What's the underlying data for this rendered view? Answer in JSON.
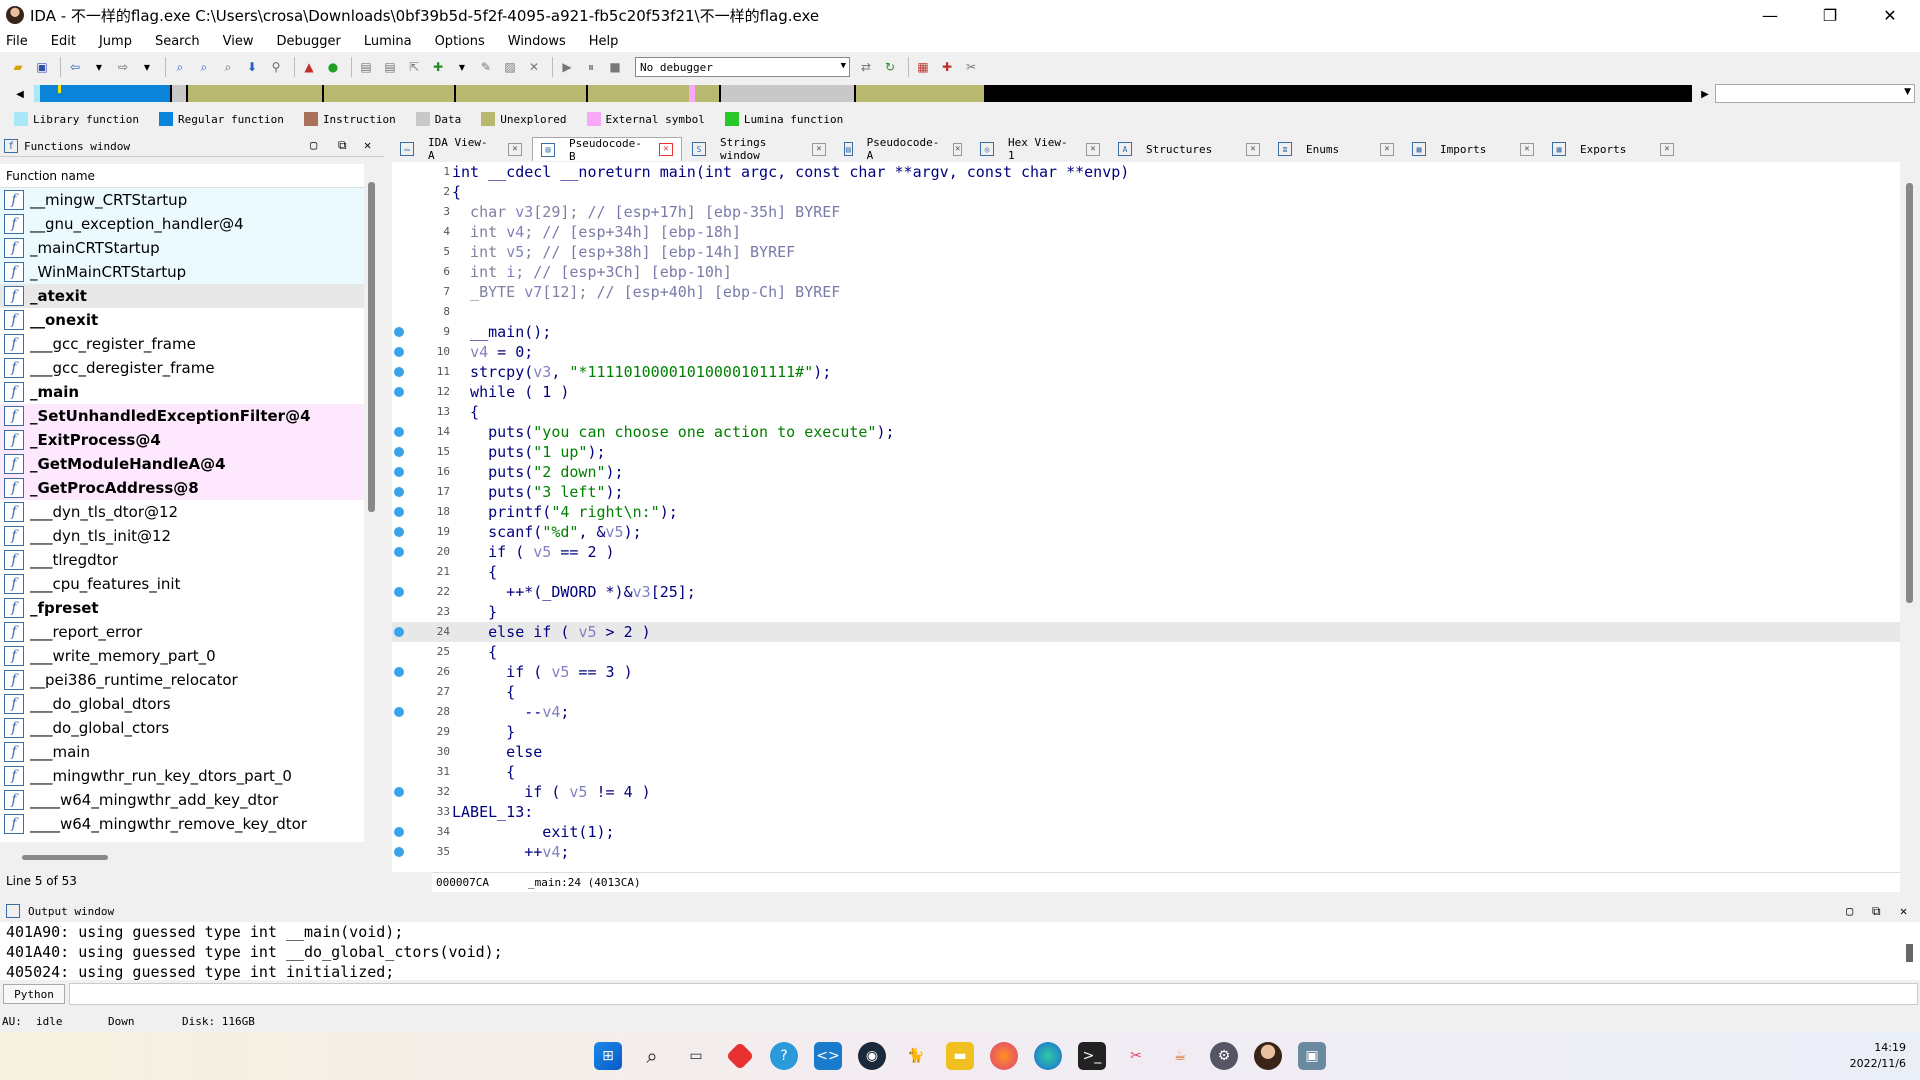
{
  "window": {
    "title": "IDA - 不一样的flag.exe C:\\Users\\crosa\\Downloads\\0bf39b5d-5f2f-4095-a921-fb5c20f53f21\\不一样的flag.exe",
    "minimize": "—",
    "restore": "❐",
    "close": "✕"
  },
  "menu": [
    "File",
    "Edit",
    "Jump",
    "Search",
    "View",
    "Debugger",
    "Lumina",
    "Options",
    "Windows",
    "Help"
  ],
  "toolbar": {
    "debugger_select": "No debugger"
  },
  "legend": [
    {
      "label": "Library function",
      "color": "#a8e8f8"
    },
    {
      "label": "Regular function",
      "color": "#0a84d8"
    },
    {
      "label": "Instruction",
      "color": "#a8725a"
    },
    {
      "label": "Data",
      "color": "#c8c8c8"
    },
    {
      "label": "Unexplored",
      "color": "#b8b870"
    },
    {
      "label": "External symbol",
      "color": "#f8a8f8"
    },
    {
      "label": "Lumina function",
      "color": "#28c828"
    }
  ],
  "functions_window": {
    "title": "Functions window",
    "column": "Function name",
    "items": [
      {
        "name": "__mingw_CRTStartup",
        "bg": "#eafaff",
        "bold": false
      },
      {
        "name": "__gnu_exception_handler@4",
        "bg": "#eafaff",
        "bold": false
      },
      {
        "name": "_mainCRTStartup",
        "bg": "#eafaff",
        "bold": false
      },
      {
        "name": "_WinMainCRTStartup",
        "bg": "#eafaff",
        "bold": false
      },
      {
        "name": "_atexit",
        "bg": "#e8e8e8",
        "bold": true
      },
      {
        "name": "__onexit",
        "bg": "#ffffff",
        "bold": true
      },
      {
        "name": "___gcc_register_frame",
        "bg": "#ffffff",
        "bold": false
      },
      {
        "name": "___gcc_deregister_frame",
        "bg": "#ffffff",
        "bold": false
      },
      {
        "name": "_main",
        "bg": "#ffffff",
        "bold": true
      },
      {
        "name": "_SetUnhandledExceptionFilter@4",
        "bg": "#fde8fd",
        "bold": true
      },
      {
        "name": "_ExitProcess@4",
        "bg": "#fde8fd",
        "bold": true
      },
      {
        "name": "_GetModuleHandleA@4",
        "bg": "#fde8fd",
        "bold": true
      },
      {
        "name": "_GetProcAddress@8",
        "bg": "#fde8fd",
        "bold": true
      },
      {
        "name": "___dyn_tls_dtor@12",
        "bg": "#ffffff",
        "bold": false
      },
      {
        "name": "___dyn_tls_init@12",
        "bg": "#ffffff",
        "bold": false
      },
      {
        "name": "___tlregdtor",
        "bg": "#ffffff",
        "bold": false
      },
      {
        "name": "___cpu_features_init",
        "bg": "#ffffff",
        "bold": false
      },
      {
        "name": "_fpreset",
        "bg": "#ffffff",
        "bold": true
      },
      {
        "name": "___report_error",
        "bg": "#ffffff",
        "bold": false
      },
      {
        "name": "___write_memory_part_0",
        "bg": "#ffffff",
        "bold": false
      },
      {
        "name": "__pei386_runtime_relocator",
        "bg": "#ffffff",
        "bold": false
      },
      {
        "name": "___do_global_dtors",
        "bg": "#ffffff",
        "bold": false
      },
      {
        "name": "___do_global_ctors",
        "bg": "#ffffff",
        "bold": false
      },
      {
        "name": "___main",
        "bg": "#ffffff",
        "bold": false
      },
      {
        "name": "___mingwthr_run_key_dtors_part_0",
        "bg": "#ffffff",
        "bold": false
      },
      {
        "name": "____w64_mingwthr_add_key_dtor",
        "bg": "#ffffff",
        "bold": false
      },
      {
        "name": "____w64_mingwthr_remove_key_dtor",
        "bg": "#ffffff",
        "bold": false
      }
    ],
    "status": "Line 5 of 53"
  },
  "tabs": [
    {
      "label": "IDA View-A",
      "active": false
    },
    {
      "label": "Pseudocode-B",
      "active": true
    },
    {
      "label": "Strings window",
      "active": false
    },
    {
      "label": "Pseudocode-A",
      "active": false
    },
    {
      "label": "Hex View-1",
      "active": false
    },
    {
      "label": "Structures",
      "active": false
    },
    {
      "label": "Enums",
      "active": false
    },
    {
      "label": "Imports",
      "active": false
    },
    {
      "label": "Exports",
      "active": false
    }
  ],
  "code": [
    {
      "n": "1",
      "dot": false,
      "t": "int __cdecl __noreturn main(int argc, const char **argv, const char **envp)"
    },
    {
      "n": "2",
      "dot": false,
      "t": "{"
    },
    {
      "n": "3",
      "dot": false,
      "t": "  char v3[29]; // [esp+17h] [ebp-35h] BYREF"
    },
    {
      "n": "4",
      "dot": false,
      "t": "  int v4; // [esp+34h] [ebp-18h]"
    },
    {
      "n": "5",
      "dot": false,
      "t": "  int v5; // [esp+38h] [ebp-14h] BYREF"
    },
    {
      "n": "6",
      "dot": false,
      "t": "  int i; // [esp+3Ch] [ebp-10h]"
    },
    {
      "n": "7",
      "dot": false,
      "t": "  _BYTE v7[12]; // [esp+40h] [ebp-Ch] BYREF"
    },
    {
      "n": "8",
      "dot": false,
      "t": ""
    },
    {
      "n": "9",
      "dot": true,
      "t": "  __main();"
    },
    {
      "n": "10",
      "dot": true,
      "t": "  v4 = 0;"
    },
    {
      "n": "11",
      "dot": true,
      "t": "  strcpy(v3, \"*11110100001010000101111#\");"
    },
    {
      "n": "12",
      "dot": true,
      "t": "  while ( 1 )"
    },
    {
      "n": "13",
      "dot": false,
      "t": "  {"
    },
    {
      "n": "14",
      "dot": true,
      "t": "    puts(\"you can choose one action to execute\");"
    },
    {
      "n": "15",
      "dot": true,
      "t": "    puts(\"1 up\");"
    },
    {
      "n": "16",
      "dot": true,
      "t": "    puts(\"2 down\");"
    },
    {
      "n": "17",
      "dot": true,
      "t": "    puts(\"3 left\");"
    },
    {
      "n": "18",
      "dot": true,
      "t": "    printf(\"4 right\\n:\");"
    },
    {
      "n": "19",
      "dot": true,
      "t": "    scanf(\"%d\", &v5);"
    },
    {
      "n": "20",
      "dot": true,
      "t": "    if ( v5 == 2 )"
    },
    {
      "n": "21",
      "dot": false,
      "t": "    {"
    },
    {
      "n": "22",
      "dot": true,
      "t": "      ++*(_DWORD *)&v3[25];"
    },
    {
      "n": "23",
      "dot": false,
      "t": "    }"
    },
    {
      "n": "24",
      "dot": true,
      "t": "    else if ( v5 > 2 )",
      "hl": true
    },
    {
      "n": "25",
      "dot": false,
      "t": "    {"
    },
    {
      "n": "26",
      "dot": true,
      "t": "      if ( v5 == 3 )"
    },
    {
      "n": "27",
      "dot": false,
      "t": "      {"
    },
    {
      "n": "28",
      "dot": true,
      "t": "        --v4;"
    },
    {
      "n": "29",
      "dot": false,
      "t": "      }"
    },
    {
      "n": "30",
      "dot": false,
      "t": "      else"
    },
    {
      "n": "31",
      "dot": false,
      "t": "      {"
    },
    {
      "n": "32",
      "dot": true,
      "t": "        if ( v5 != 4 )"
    },
    {
      "n": "33",
      "dot": false,
      "t": "LABEL_13:"
    },
    {
      "n": "34",
      "dot": true,
      "t": "          exit(1);"
    },
    {
      "n": "35",
      "dot": true,
      "t": "        ++v4;"
    }
  ],
  "code_status": {
    "addr": "000007CA",
    "loc": "_main:24 (4013CA)"
  },
  "output_window": {
    "title": "Output window",
    "lines": [
      "401A90: using guessed type int __main(void);",
      "401A40: using guessed type int __do_global_ctors(void);",
      "405024: using guessed type int initialized;"
    ]
  },
  "python_button": "Python",
  "status": {
    "au": "AU:",
    "state": "idle",
    "dir": "Down",
    "disk": "Disk: 116GB"
  },
  "clock": {
    "time": "14:19",
    "date": "2022/11/6"
  },
  "taskbar_icons": [
    "windows-start-icon",
    "search-icon",
    "task-view-icon",
    "app-red-icon",
    "help-app-icon",
    "vscode-icon",
    "app-dark-icon",
    "cat-app-icon",
    "file-explorer-icon",
    "firefox-icon",
    "edge-icon",
    "terminal-icon",
    "snipping-icon",
    "java-icon",
    "settings-icon",
    "ida-icon",
    "app-terminal-icon"
  ]
}
